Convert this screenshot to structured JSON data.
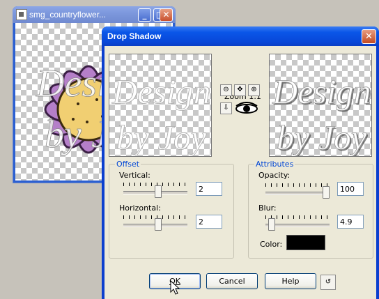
{
  "background_window": {
    "title": "smg_countryflower...",
    "watermark_line1": "Design",
    "watermark_line2": "by Joy"
  },
  "dialog": {
    "title": "Drop Shadow",
    "zoom_label": "Zoom 1:1",
    "preview_watermark_line1": "Design",
    "preview_watermark_line2": "by Joy",
    "offset": {
      "legend": "Offset",
      "vertical_label": "Vertical:",
      "vertical_value": "2",
      "vertical_level": 0.55,
      "horizontal_label": "Horizontal:",
      "horizontal_value": "2",
      "horizontal_level": 0.55
    },
    "attributes": {
      "legend": "Attributes",
      "opacity_label": "Opacity:",
      "opacity_value": "100",
      "opacity_level": 1.0,
      "blur_label": "Blur:",
      "blur_value": "4.9",
      "blur_level": 0.05,
      "color_label": "Color:",
      "color_value": "#000000"
    },
    "buttons": {
      "ok": "OK",
      "cancel": "Cancel",
      "help": "Help"
    }
  }
}
